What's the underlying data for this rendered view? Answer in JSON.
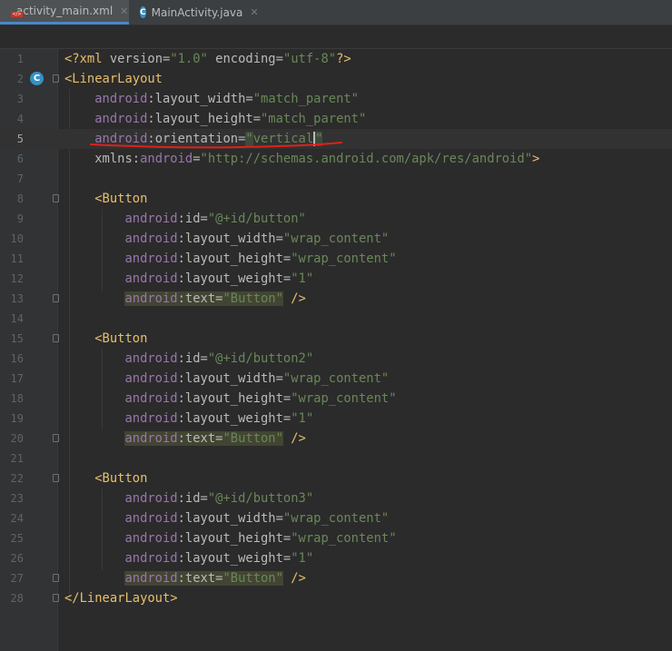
{
  "tabs": [
    {
      "label": "activity_main.xml",
      "icon": "xml-file-icon",
      "active": true
    },
    {
      "label": "MainActivity.java",
      "icon": "java-class-icon",
      "active": false
    }
  ],
  "gutter_icon_letter": "C",
  "lines": [
    {
      "n": "1"
    },
    {
      "n": "2"
    },
    {
      "n": "3"
    },
    {
      "n": "4"
    },
    {
      "n": "5"
    },
    {
      "n": "6"
    },
    {
      "n": "7"
    },
    {
      "n": "8"
    },
    {
      "n": "9"
    },
    {
      "n": "10"
    },
    {
      "n": "11"
    },
    {
      "n": "12"
    },
    {
      "n": "13"
    },
    {
      "n": "14"
    },
    {
      "n": "15"
    },
    {
      "n": "16"
    },
    {
      "n": "17"
    },
    {
      "n": "18"
    },
    {
      "n": "19"
    },
    {
      "n": "20"
    },
    {
      "n": "21"
    },
    {
      "n": "22"
    },
    {
      "n": "23"
    },
    {
      "n": "24"
    },
    {
      "n": "25"
    },
    {
      "n": "26"
    },
    {
      "n": "27"
    },
    {
      "n": "28"
    }
  ],
  "code": {
    "xml_decl": {
      "open": "<?xml",
      "k1": " version=",
      "v1": "\"1.0\"",
      "k2": " encoding=",
      "v2": "\"utf-8\"",
      "close": "?>"
    },
    "root_open": "<LinearLayout",
    "root_close": "</LinearLayout>",
    "ns": "android",
    "colon": ":",
    "eq": "=",
    "root_attrs": {
      "layout_width": "layout_width",
      "layout_width_val": "\"match_parent\"",
      "layout_height": "layout_height",
      "layout_height_val": "\"match_parent\"",
      "orientation": "orientation",
      "orientation_q1": "\"",
      "orientation_val": "vertical",
      "orientation_q2": "\"",
      "xmlns": "xmlns:",
      "xmlns_ns": "android",
      "xmlns_val": "\"http://schemas.android.com/apk/res/android\"",
      "xmlns_close": ">"
    },
    "button_open": "<Button",
    "button_close": " />",
    "attr_names": {
      "id": "id",
      "width": "layout_width",
      "height": "layout_height",
      "weight": "layout_weight",
      "text": "text"
    },
    "buttons": [
      {
        "id": "\"@+id/button\"",
        "width": "\"wrap_content\"",
        "height": "\"wrap_content\"",
        "weight": "\"1\"",
        "text": "\"Button\""
      },
      {
        "id": "\"@+id/button2\"",
        "width": "\"wrap_content\"",
        "height": "\"wrap_content\"",
        "weight": "\"1\"",
        "text": "\"Button\""
      },
      {
        "id": "\"@+id/button3\"",
        "width": "\"wrap_content\"",
        "height": "\"wrap_content\"",
        "weight": "\"1\"",
        "text": "\"Button\""
      }
    ]
  },
  "colors": {
    "background": "#2b2b2b",
    "tag": "#e8bf6a",
    "namespace": "#9876aa",
    "string": "#6a8759",
    "attribute": "#bababa",
    "annotation_underline": "#e0201a",
    "accent": "#4a88c7"
  }
}
